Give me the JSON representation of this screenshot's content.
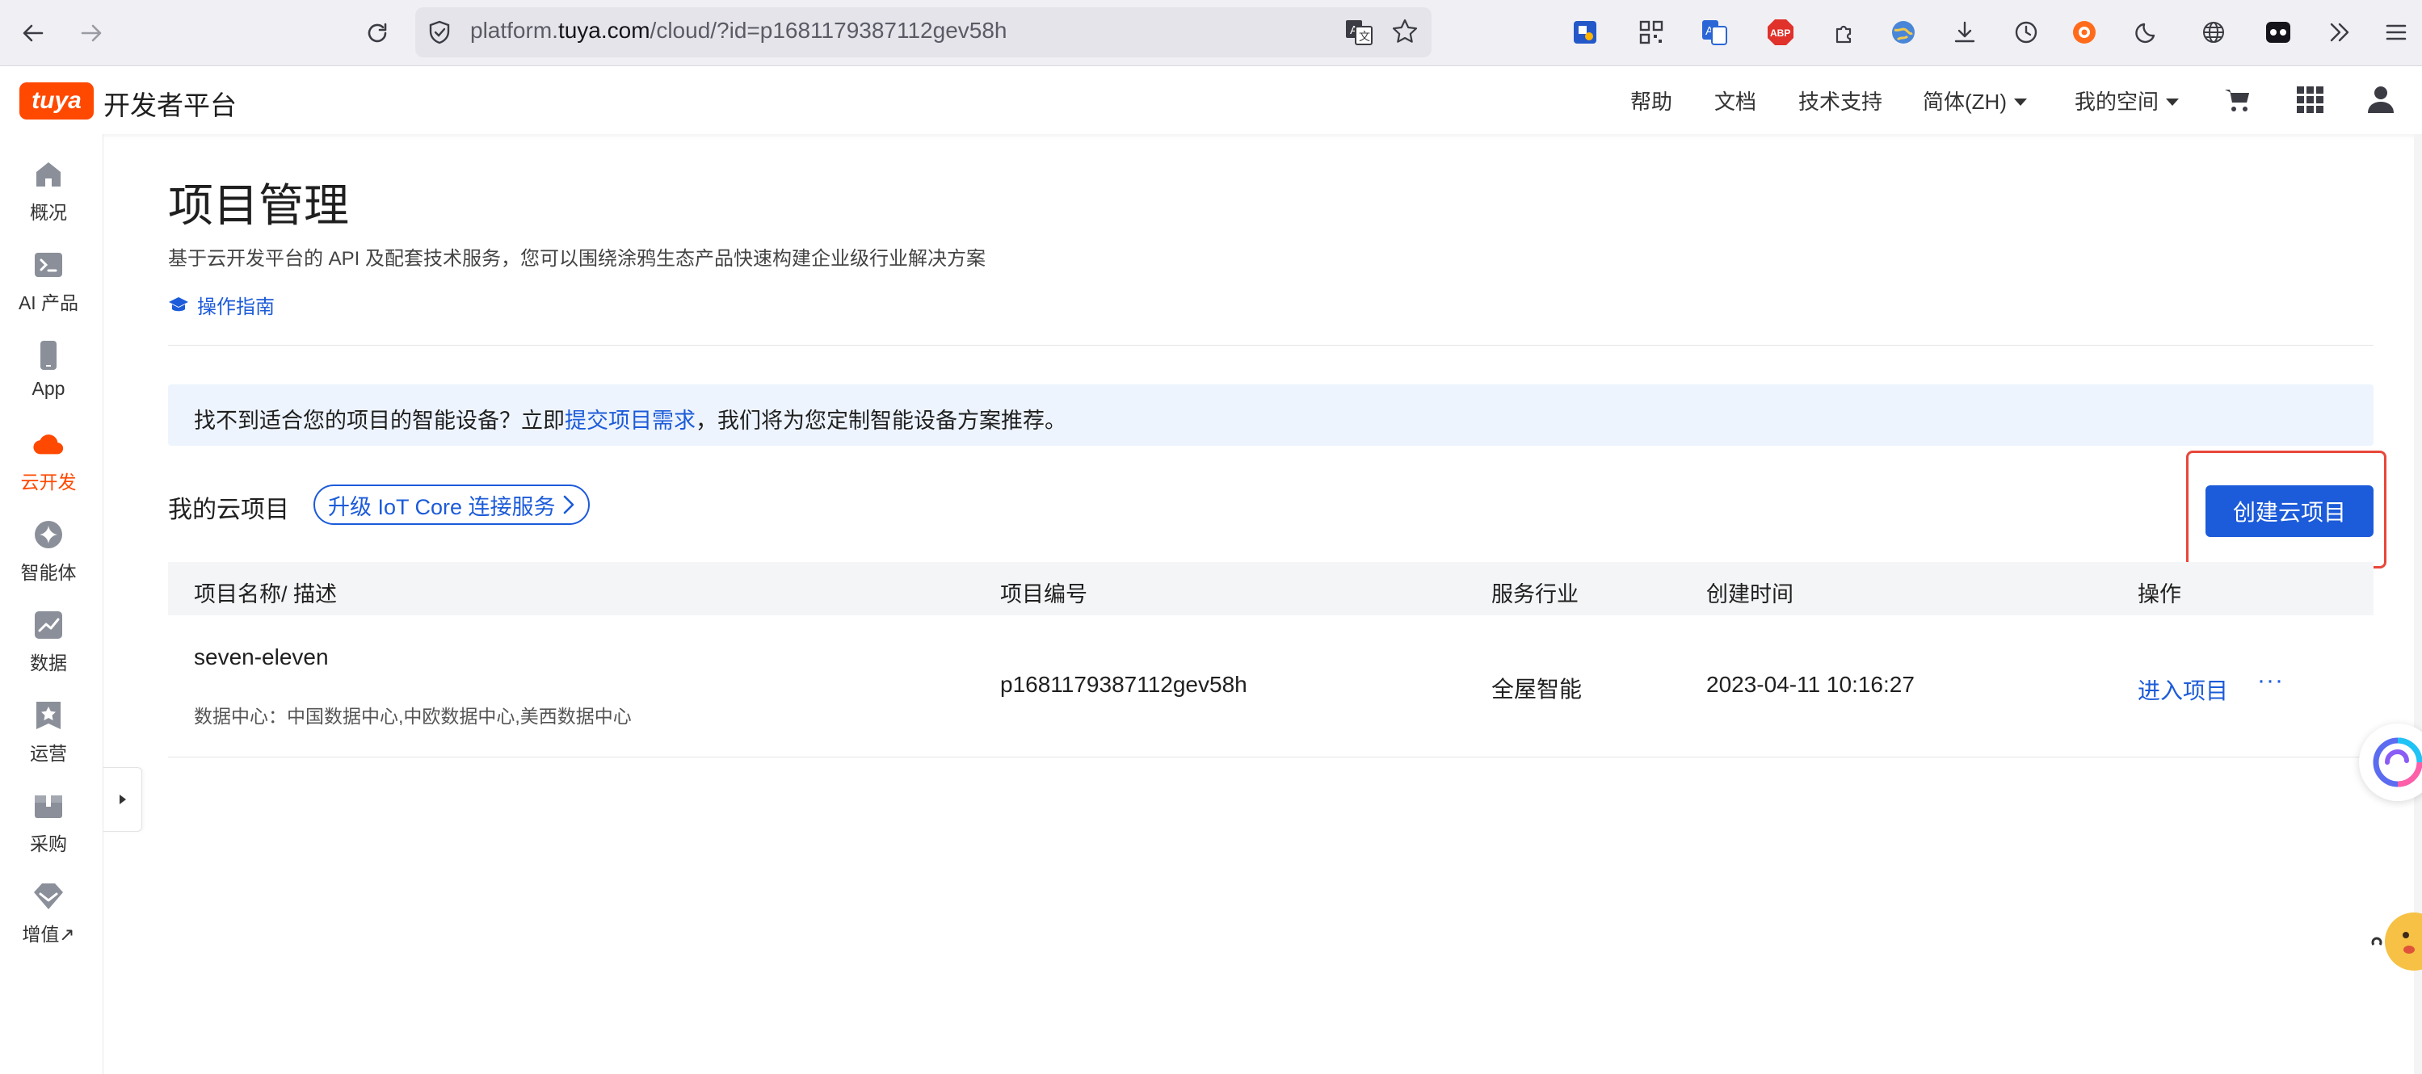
{
  "browser": {
    "url_prefix": "platform.",
    "url_domain": "tuya.com",
    "url_path": "/cloud/?id=p1681179387112gev58h"
  },
  "header": {
    "logo_text": "tuya",
    "platform_name": "开发者平台",
    "nav": {
      "help": "帮助",
      "docs": "文档",
      "support": "技术支持",
      "language": "简体(ZH)",
      "my_space": "我的空间"
    }
  },
  "sidebar": {
    "items": [
      {
        "label": "概况",
        "icon": "home-icon"
      },
      {
        "label": "AI 产品",
        "icon": "terminal-icon"
      },
      {
        "label": "App",
        "icon": "phone-icon"
      },
      {
        "label": "云开发",
        "icon": "cloud-icon"
      },
      {
        "label": "智能体",
        "icon": "sparkle-icon"
      },
      {
        "label": "数据",
        "icon": "chart-icon"
      },
      {
        "label": "运营",
        "icon": "star-badge-icon"
      },
      {
        "label": "采购",
        "icon": "box-icon"
      },
      {
        "label": "增值↗",
        "icon": "diamond-icon"
      }
    ],
    "active_color": "#ff4800"
  },
  "main": {
    "title": "项目管理",
    "description": "基于云开发平台的 API 及配套技术服务，您可以围绕涂鸦生态产品快速构建企业级行业解决方案",
    "guide_link": "操作指南",
    "notice": {
      "before": "找不到适合您的项目的智能设备？立即",
      "link": "提交项目需求",
      "after": "，我们将为您定制智能设备方案推荐。"
    },
    "my_projects_label": "我的云项目",
    "upgrade_label": "升级 IoT Core 连接服务",
    "create_button": "创建云项目",
    "table": {
      "headers": {
        "name": "项目名称/ 描述",
        "id": "项目编号",
        "industry": "服务行业",
        "created": "创建时间",
        "actions": "操作"
      },
      "rows": [
        {
          "name": "seven-eleven",
          "description": "数据中心：中国数据中心,中欧数据中心,美西数据中心",
          "id": "p1681179387112gev58h",
          "industry": "全屋智能",
          "created": "2023-04-11 10:16:27",
          "enter": "进入项目",
          "more": "···"
        }
      ]
    }
  },
  "colors": {
    "brand": "#ff4800",
    "link": "#1c5bd9",
    "notice_bg": "#eef4fd",
    "highlight": "#e8473a"
  }
}
